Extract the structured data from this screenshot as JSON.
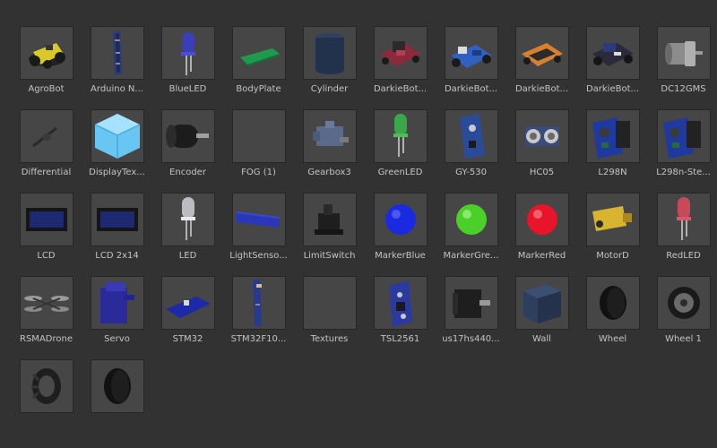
{
  "assets": [
    {
      "label": "AgroBot",
      "icon": "agrobot-icon"
    },
    {
      "label": "Arduino N...",
      "icon": "arduino-icon"
    },
    {
      "label": "BlueLED",
      "icon": "blue-led-icon"
    },
    {
      "label": "BodyPlate",
      "icon": "green-plate-icon"
    },
    {
      "label": "Cylinder",
      "icon": "cylinder-icon"
    },
    {
      "label": "DarkieBot...",
      "icon": "red-robot-icon"
    },
    {
      "label": "DarkieBot...",
      "icon": "blue-robot-icon"
    },
    {
      "label": "DarkieBot...",
      "icon": "orange-robot-icon"
    },
    {
      "label": "DarkieBot...",
      "icon": "dark-robot-icon"
    },
    {
      "label": "DC12GMS",
      "icon": "dc-motor-icon"
    },
    {
      "label": "Differential",
      "icon": "differential-icon"
    },
    {
      "label": "DisplayTex...",
      "icon": "text-mesh-cube-icon"
    },
    {
      "label": "Encoder",
      "icon": "encoder-icon"
    },
    {
      "label": "FOG (1)",
      "icon": "empty-thumbnail"
    },
    {
      "label": "Gearbox3",
      "icon": "gearbox-icon"
    },
    {
      "label": "GreenLED",
      "icon": "green-led-icon"
    },
    {
      "label": "GY-530",
      "icon": "gy530-board-icon"
    },
    {
      "label": "HC05",
      "icon": "ultrasonic-sensor-icon"
    },
    {
      "label": "L298N",
      "icon": "motor-driver-icon"
    },
    {
      "label": "L298n-Ste...",
      "icon": "motor-driver-icon"
    },
    {
      "label": "LCD",
      "icon": "lcd-icon"
    },
    {
      "label": "LCD 2x14",
      "icon": "lcd-icon"
    },
    {
      "label": "LED",
      "icon": "white-led-icon"
    },
    {
      "label": "LightSenso...",
      "icon": "light-sensor-bar-icon"
    },
    {
      "label": "LimitSwitch",
      "icon": "limit-switch-icon"
    },
    {
      "label": "MarkerBlue",
      "icon": "blue-sphere-icon"
    },
    {
      "label": "MarkerGre...",
      "icon": "green-sphere-icon"
    },
    {
      "label": "MarkerRed",
      "icon": "red-sphere-icon"
    },
    {
      "label": "MotorD",
      "icon": "yellow-gear-motor-icon"
    },
    {
      "label": "RedLED",
      "icon": "red-led-icon"
    },
    {
      "label": "RSMADrone",
      "icon": "drone-icon"
    },
    {
      "label": "Servo",
      "icon": "servo-icon"
    },
    {
      "label": "STM32",
      "icon": "stm32-board-icon"
    },
    {
      "label": "STM32F10...",
      "icon": "stm32-stick-icon"
    },
    {
      "label": "Textures",
      "icon": "empty-thumbnail"
    },
    {
      "label": "TSL2561",
      "icon": "tsl2561-board-icon"
    },
    {
      "label": "us17hs440...",
      "icon": "stepper-motor-icon"
    },
    {
      "label": "Wall",
      "icon": "wall-cube-icon"
    },
    {
      "label": "Wheel",
      "icon": "wheel-icon"
    },
    {
      "label": "Wheel 1",
      "icon": "wheel-rim-icon"
    },
    {
      "label": "",
      "icon": "tractor-tire-icon"
    },
    {
      "label": "",
      "icon": "tire-icon"
    }
  ],
  "colors": {
    "background": "#323232",
    "thumbnail": "#464646",
    "label": "#c4c4c4"
  }
}
